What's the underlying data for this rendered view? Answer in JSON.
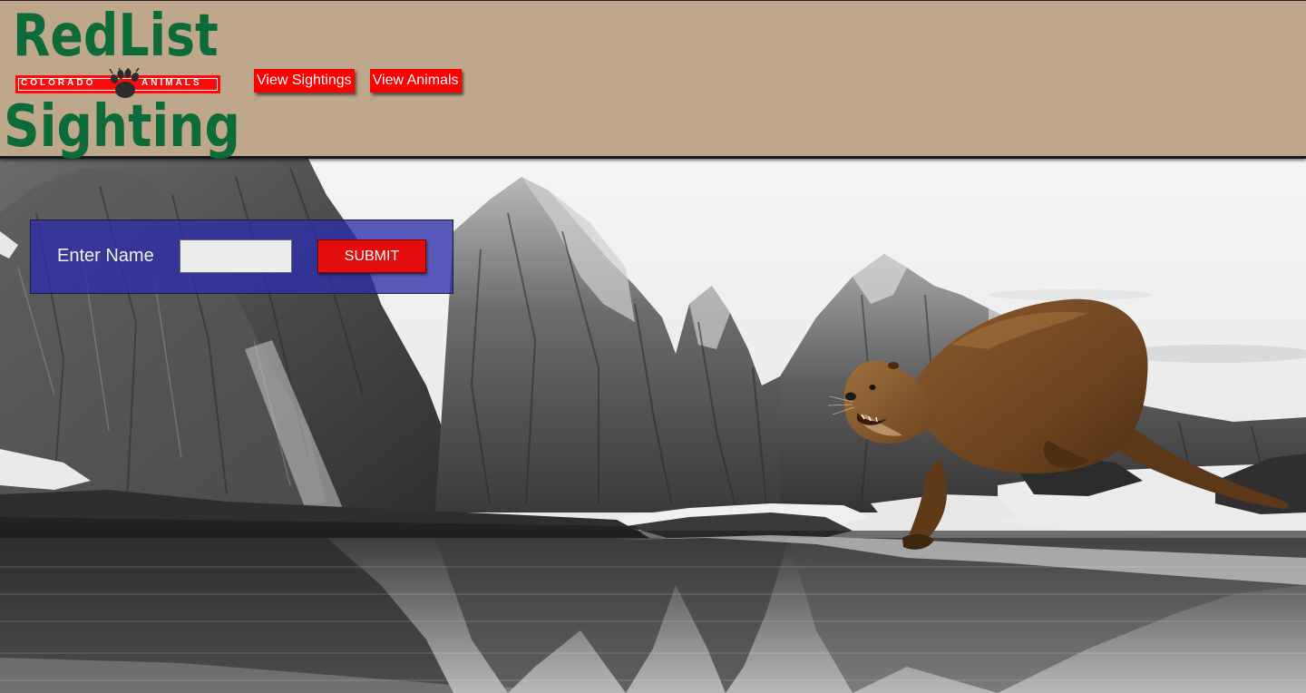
{
  "logo": {
    "title_top": "RedList",
    "band_left": "COLORADO",
    "band_right": "ANIMALS",
    "title_bottom": "Sighting",
    "paw_icon": "bear-paw-icon"
  },
  "nav": {
    "view_sightings": "View Sightings",
    "view_animals": "View Animals"
  },
  "form": {
    "label": "Enter Name",
    "input_value": "",
    "submit": "SUBMIT"
  },
  "colors": {
    "header_bg": "#bea78c",
    "logo_green": "#0d6b3a",
    "nav_red": "#ff0000",
    "panel_blue": "#2d2daa",
    "submit_red": "#e40d0d"
  }
}
